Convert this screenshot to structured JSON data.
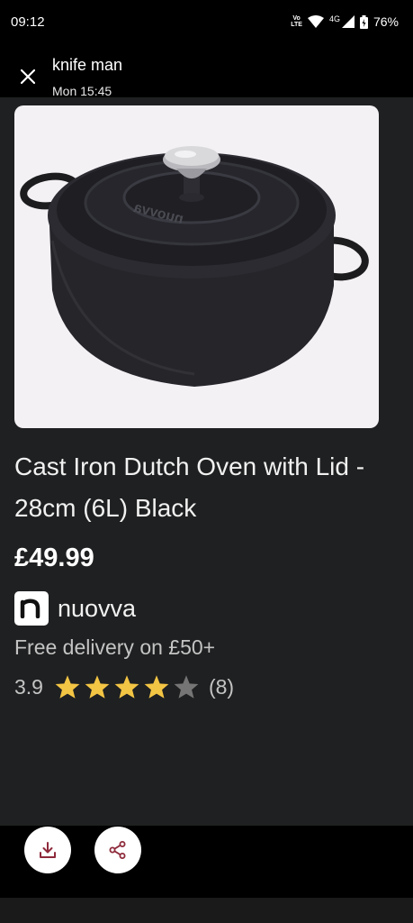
{
  "status_bar": {
    "time": "09:12",
    "volte_top": "Vo",
    "volte_bottom": "LTE",
    "network": "4G",
    "battery": "76%"
  },
  "header": {
    "title": "knife man",
    "subtitle": "Mon 15:45"
  },
  "product": {
    "image_icon": "dutch-oven-image",
    "brand_engraving": "nuovva",
    "title": "Cast Iron Dutch Oven with Lid - 28cm (6L) Black",
    "price": "£49.99",
    "merchant_name": "nuovva",
    "delivery": "Free delivery on £50+",
    "rating_value": "3.9",
    "rating_stars": 4,
    "rating_stars_max": 5,
    "rating_count": "(8)"
  },
  "actions": {
    "download_icon": "download-icon",
    "share_icon": "share-icon"
  },
  "colors": {
    "card_bg": "#1f2021",
    "star_filled": "#f3c544",
    "star_empty": "#757575",
    "action_icon": "#8e2a3b"
  }
}
